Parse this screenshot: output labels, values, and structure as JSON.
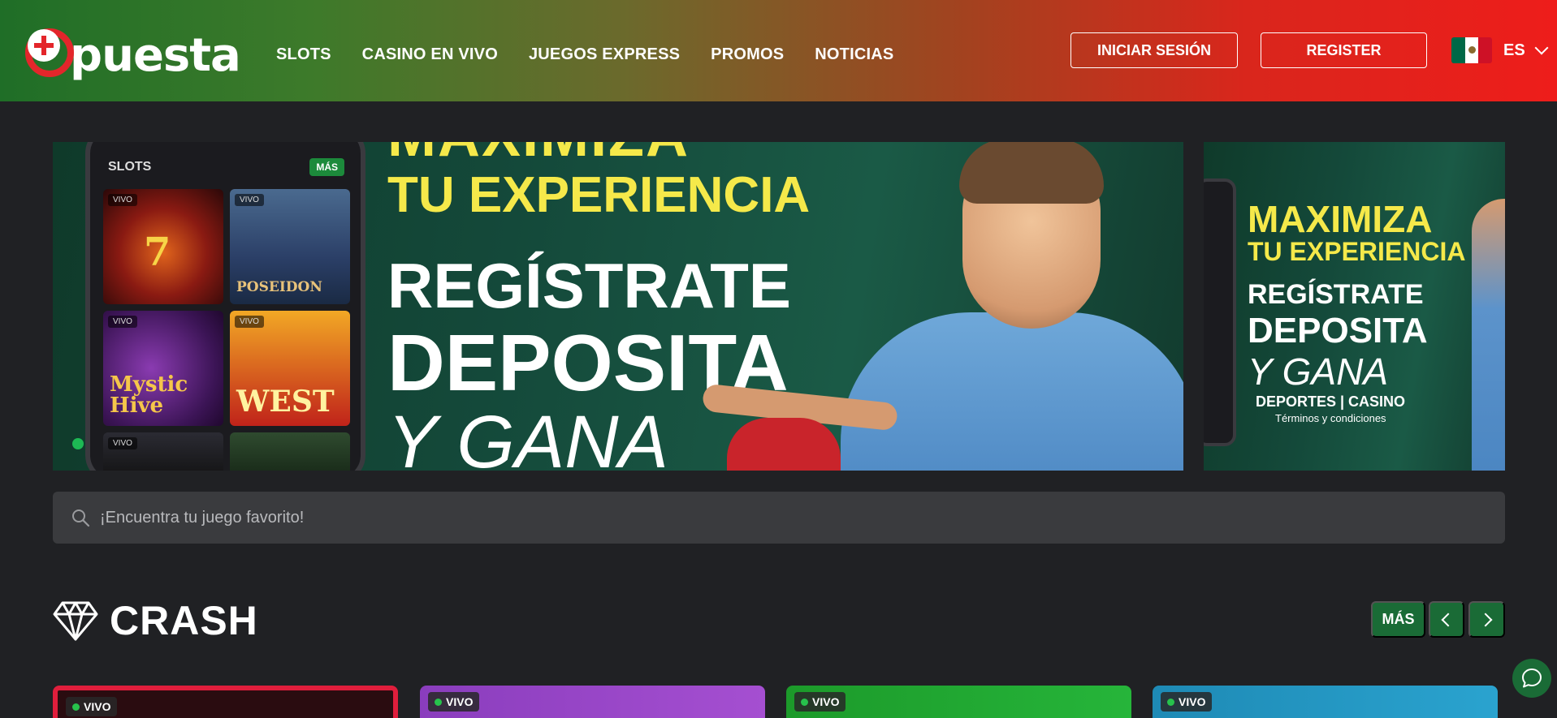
{
  "header": {
    "logo_text": "puesta",
    "nav": [
      "SLOTS",
      "CASINO EN VIVO",
      "JUEGOS EXPRESS",
      "PROMOS",
      "NOTICIAS"
    ],
    "login_label": "INICIAR SESIÓN",
    "register_label": "REGISTER",
    "language": "ES"
  },
  "banner_main": {
    "phone_section": "SLOTS",
    "phone_more": "MÁS",
    "tiles": [
      {
        "badge": "VIVO",
        "name": "7"
      },
      {
        "badge": "VIVO",
        "name": "POSEIDON"
      },
      {
        "badge": "VIVO",
        "name": "Mystic Hive"
      },
      {
        "badge": "VIVO",
        "name": "WEST"
      },
      {
        "badge": "VIVO",
        "name": ""
      },
      {
        "badge": "",
        "name": ""
      }
    ],
    "line_top": "MAXIMIZA",
    "line1": "TU EXPERIENCIA",
    "line2": "REGÍSTRATE",
    "line3": "DEPOSITA",
    "line4": "Y GANA"
  },
  "banner_side": {
    "line1": "MAXIMIZA",
    "line2": "TU EXPERIENCIA",
    "line3": "REGÍSTRATE",
    "line4": "DEPOSITA",
    "line5": "Y GANA",
    "line6": "DEPORTES | CASINO",
    "line7": "Términos y condiciones"
  },
  "search": {
    "placeholder": "¡Encuentra tu juego favorito!"
  },
  "section": {
    "title": "CRASH",
    "more_label": "MÁS",
    "cards": [
      {
        "badge": "VIVO"
      },
      {
        "badge": "VIVO"
      },
      {
        "badge": "VIVO"
      },
      {
        "badge": "VIVO"
      }
    ]
  },
  "colors": {
    "accent_green": "#1a6b36",
    "header_left": "#1f6e27",
    "header_right": "#ee1d1b",
    "background": "#202124"
  },
  "icons": {
    "search": "search-icon",
    "diamond": "diamond-icon",
    "chat": "chat-icon",
    "language_chevron": "chevron-down-icon"
  }
}
